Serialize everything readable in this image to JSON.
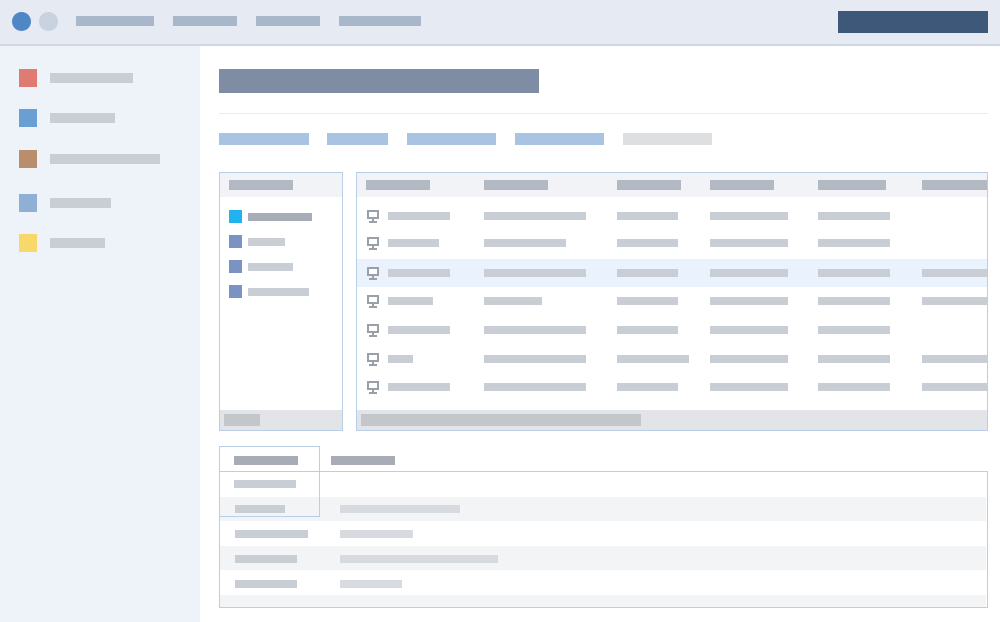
{
  "window": {
    "controls": [
      {
        "name": "window-close-button",
        "color": "#4f86c6"
      },
      {
        "name": "window-minimize-button",
        "color": "#c9d2e0"
      }
    ],
    "menu_placeholders": 4,
    "primary_action_color": "#3e587a"
  },
  "sidebar": {
    "items": [
      {
        "name": "sidebar-item-1",
        "color": "#df7b72"
      },
      {
        "name": "sidebar-item-2",
        "color": "#6a9fd4"
      },
      {
        "name": "sidebar-item-3",
        "color": "#b88e6d"
      },
      {
        "name": "sidebar-item-4",
        "color": "#8fb0d4"
      },
      {
        "name": "sidebar-item-5",
        "color": "#f7d86a"
      }
    ]
  },
  "tree": {
    "items": [
      {
        "name": "tree-item-1",
        "color": "#21b2f0",
        "selected": true
      },
      {
        "name": "tree-item-2",
        "color": "#7a93c2"
      },
      {
        "name": "tree-item-3",
        "color": "#7a93c2"
      },
      {
        "name": "tree-item-4",
        "color": "#7a93c2"
      }
    ]
  },
  "table": {
    "row_count": 7,
    "selected_row": 3,
    "row_icon": "monitor-icon"
  },
  "details": {
    "tabs": [
      {
        "name": "tab-details-1",
        "active": true
      },
      {
        "name": "tab-details-2",
        "active": false
      }
    ],
    "row_count": 5
  },
  "colors": {
    "title_bar": "#7e8da3",
    "tab_link": "#a8c4e2",
    "tab_link_disabled": "#dedfe1",
    "text_placeholder": "#c9ced5",
    "header_placeholder": "#b3b9c2",
    "selected_row_bg": "#eaf3fd",
    "panel_border": "#b9cfe8"
  }
}
